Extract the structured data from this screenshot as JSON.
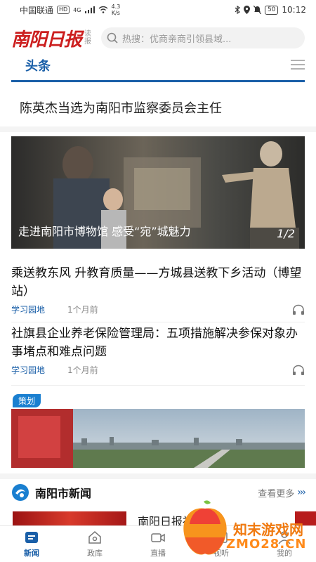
{
  "status_bar": {
    "carrier": "中国联通",
    "hd_badge": "HD",
    "network": "4G",
    "speed_value": "4.3",
    "speed_unit": "K/s",
    "battery": "50",
    "time": "10:12"
  },
  "header": {
    "logo_text": "南阳日报",
    "logo_sub": "读报",
    "search_placeholder": "热搜：优商亲商引领县域..."
  },
  "tabs": {
    "active_label": "头条"
  },
  "headline": "陈英杰当选为南阳市监察委员会主任",
  "carousel": {
    "caption": "走进南阳市博物馆 感受“宛”城魅力",
    "page": "1/2"
  },
  "news": [
    {
      "title": "乘送教东风 升教育质量——方城县送教下乡活动（博望站）",
      "source": "学习园地",
      "time": "1个月前"
    },
    {
      "title": "社旗县企业养老保险管理局：五项措施解决参保对象办事堵点和难点问题",
      "source": "学习园地",
      "time": "1个月前"
    }
  ],
  "feature": {
    "tag": "策划"
  },
  "section": {
    "title": "南阳市新闻",
    "more": "查看更多",
    "arrows": "›››"
  },
  "teaser": {
    "title": "南阳日报社平台"
  },
  "bottom_nav": [
    {
      "label": "新闻",
      "icon": "news-icon"
    },
    {
      "label": "政库",
      "icon": "home-icon"
    },
    {
      "label": "直播",
      "icon": "video-icon"
    },
    {
      "label": "视听",
      "icon": "media-icon"
    },
    {
      "label": "我的",
      "icon": "user-icon"
    }
  ],
  "watermark": {
    "line1": "知末游戏网",
    "line2": "ZMO28.CN"
  },
  "colors": {
    "brand_red": "#cc1f1f",
    "accent_blue": "#1a5fa8",
    "watermark_orange": "#f07a10"
  }
}
